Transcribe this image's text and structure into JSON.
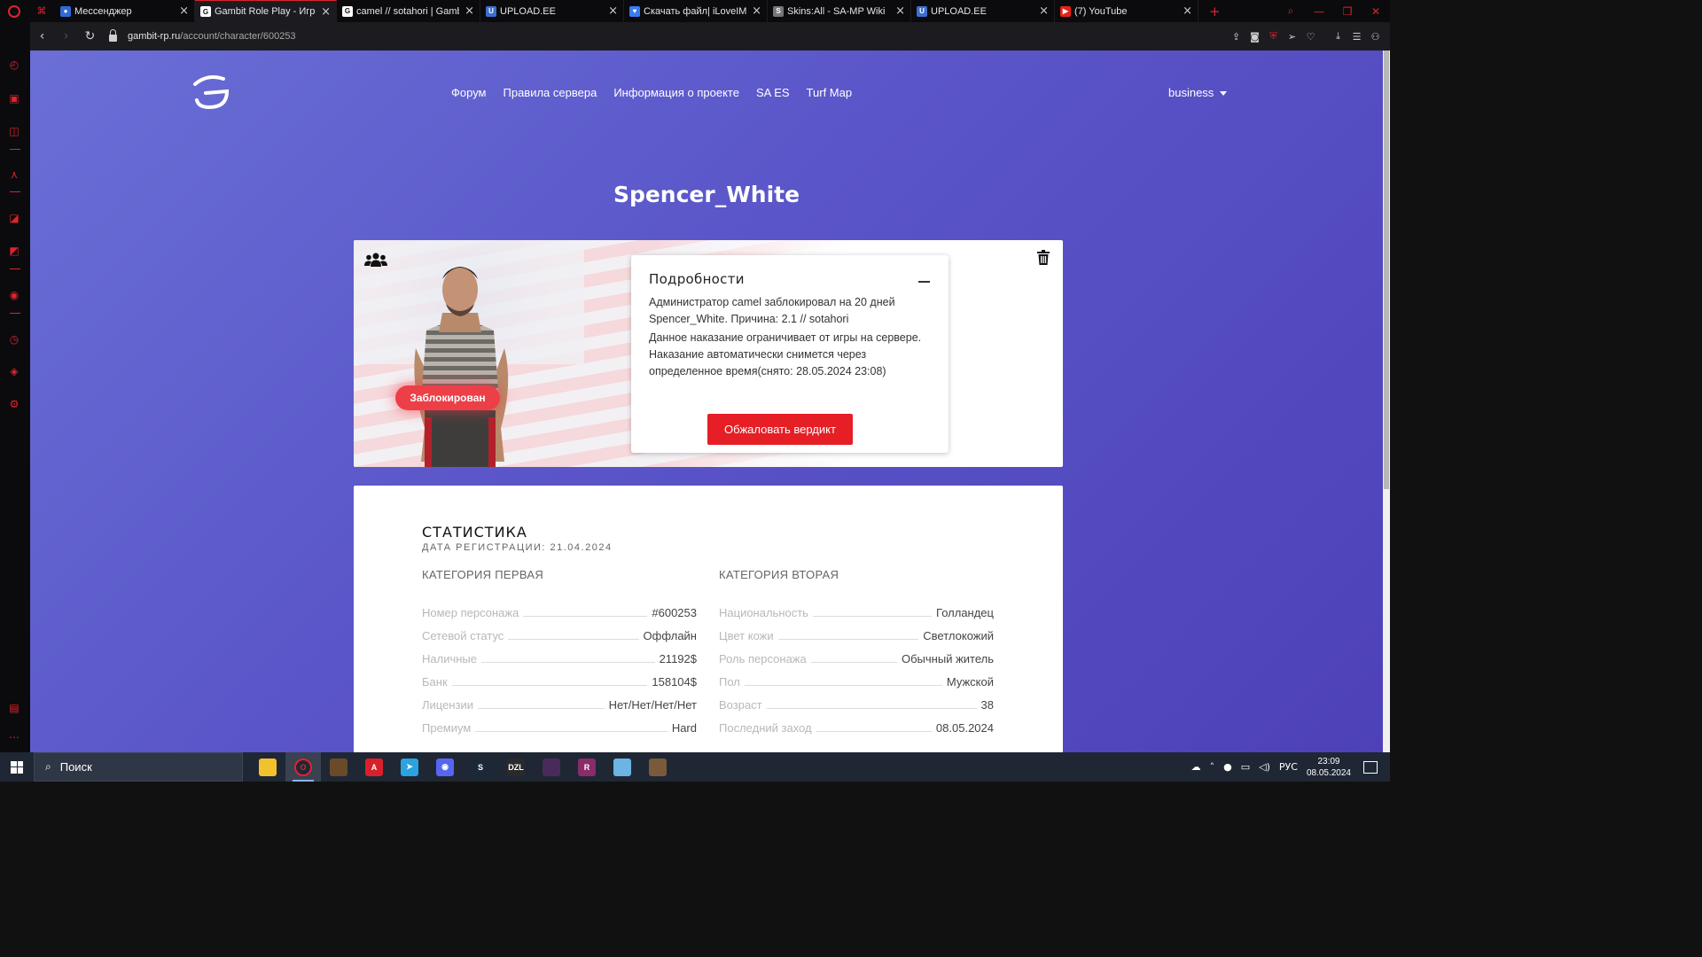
{
  "browser": {
    "tabs": [
      {
        "title": "Мессенджер",
        "fav_color": "#2f6ad8",
        "fav_char": "●",
        "width": 158,
        "active": false
      },
      {
        "title": "Gambit Role Play - Игровой",
        "fav_color": "#ffffff",
        "fav_char": "G",
        "width": 160,
        "active": true
      },
      {
        "title": "camel // sotahori | Gambit",
        "fav_color": "#ffffff",
        "fav_char": "G",
        "width": 162,
        "active": false
      },
      {
        "title": "UPLOAD.EE",
        "fav_color": "#3c6fd0",
        "fav_char": "U",
        "width": 162,
        "active": false
      },
      {
        "title": "Скачать файл| iLoveIMG",
        "fav_color": "#3b7cf0",
        "fav_char": "♥",
        "width": 162,
        "active": false
      },
      {
        "title": "Skins:All - SA-MP Wiki",
        "fav_color": "#777777",
        "fav_char": "S",
        "width": 162,
        "active": false
      },
      {
        "title": "UPLOAD.EE",
        "fav_color": "#3c6fd0",
        "fav_char": "U",
        "width": 162,
        "active": false
      },
      {
        "title": "(7) YouTube",
        "fav_color": "#e62117",
        "fav_char": "▶",
        "width": 162,
        "active": false
      }
    ],
    "url_host": "gambit-rp.ru",
    "url_path": "/account/character/600253"
  },
  "site": {
    "nav": [
      "Форум",
      "Правила сервера",
      "Информация о проекте",
      "SA ES",
      "Turf Map"
    ],
    "user": "business"
  },
  "character": {
    "name": "Spencer_White",
    "status_badge": "Заблокирован",
    "details": {
      "title": "Подробности",
      "text1": "Администратор camel заблокировал на 20 дней Spencer_White. Причина: 2.1 // sotahori",
      "text2": "Данное наказание ограничивает от игры на сервере. Наказание автоматически снимется через определенное время(снято: 28.05.2024 23:08)",
      "appeal_button": "Обжаловать вердикт"
    }
  },
  "stats": {
    "title": "СТАТИСТИКА",
    "reg_date": "ДАТА РЕГИСТРАЦИИ: 21.04.2024",
    "cat1": {
      "title": "КАТЕГОРИЯ ПЕРВАЯ",
      "rows": [
        {
          "k": "Номер персонажа",
          "v": "#600253"
        },
        {
          "k": "Сетевой статус",
          "v": "Оффлайн"
        },
        {
          "k": "Наличные",
          "v": "21192$"
        },
        {
          "k": "Банк",
          "v": "158104$"
        },
        {
          "k": "Лицензии",
          "v": "Нет/Нет/Нет/Нет"
        },
        {
          "k": "Премиум",
          "v": "Hard"
        }
      ]
    },
    "cat2": {
      "title": "КАТЕГОРИЯ ВТОРАЯ",
      "rows": [
        {
          "k": "Национальность",
          "v": "Голландец"
        },
        {
          "k": "Цвет кожи",
          "v": "Светлокожий"
        },
        {
          "k": "Роль персонажа",
          "v": "Обычный житель"
        },
        {
          "k": "Пол",
          "v": "Мужской"
        },
        {
          "k": "Возраст",
          "v": "38"
        },
        {
          "k": "Последний заход",
          "v": "08.05.2024"
        }
      ]
    }
  },
  "taskbar": {
    "search_placeholder": "Поиск",
    "apps": [
      {
        "name": "file-explorer",
        "color": "#f2c12e",
        "char": ""
      },
      {
        "name": "opera",
        "color": "#1f2735",
        "char": "O"
      },
      {
        "name": "game-1",
        "color": "#6b4a2a",
        "char": ""
      },
      {
        "name": "app-red",
        "color": "#d9202a",
        "char": "A"
      },
      {
        "name": "telegram",
        "color": "#2aa3e0",
        "char": "➤"
      },
      {
        "name": "discord",
        "color": "#5865f2",
        "char": "◉"
      },
      {
        "name": "steam",
        "color": "#1b2838",
        "char": "S"
      },
      {
        "name": "dzl",
        "color": "#2a2a2a",
        "char": "DZL"
      },
      {
        "name": "game-2",
        "color": "#4a2a5a",
        "char": ""
      },
      {
        "name": "winrar",
        "color": "#8a2b6a",
        "char": "R"
      },
      {
        "name": "notepad",
        "color": "#6cb4e4",
        "char": ""
      },
      {
        "name": "game-3",
        "color": "#7a5a3a",
        "char": ""
      }
    ],
    "lang": "РУС",
    "time": "23:09",
    "date": "08.05.2024"
  }
}
